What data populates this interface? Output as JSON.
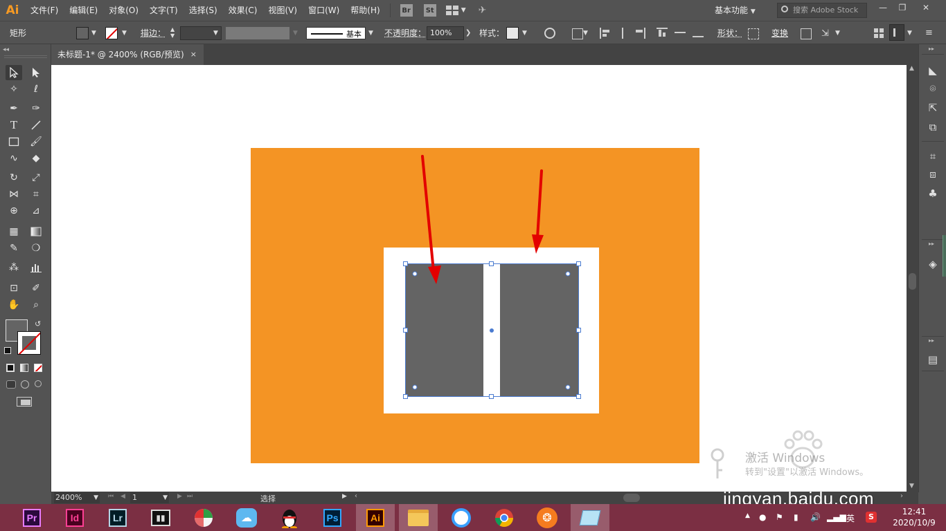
{
  "app": {
    "logo": "Ai"
  },
  "menu": [
    "文件(F)",
    "编辑(E)",
    "对象(O)",
    "文字(T)",
    "选择(S)",
    "效果(C)",
    "视图(V)",
    "窗口(W)",
    "帮助(H)"
  ],
  "bridge": {
    "br": "Br",
    "st": "St"
  },
  "workspace": "基本功能",
  "search_placeholder": "搜索 Adobe Stock",
  "control": {
    "object_type": "矩形",
    "stroke_label": "描边：",
    "stroke_style": "基本",
    "opacity_label": "不透明度：",
    "opacity_value": "100%",
    "style_label": "样式：",
    "shape_label": "形状：",
    "transform_label": "变换"
  },
  "document_tab": {
    "title": "未标题-1* @ 2400% (RGB/预览)",
    "close": "×"
  },
  "status": {
    "zoom": "2400%",
    "artboard": "1",
    "tool_status": "选择"
  },
  "watermark": {
    "line1": "激活 Windows",
    "line2": "转到\"设置\"以激活 Windows。",
    "baidu": "jingyan.baidu.com"
  },
  "taskbar": {
    "apps": [
      "Pr",
      "Id",
      "Lr",
      "Ai",
      "Ps"
    ],
    "ime": "英",
    "time": "12:41",
    "date": "2020/10/9"
  },
  "colors": {
    "artboard": "#f49424",
    "rect_fill": "#646464",
    "arrow": "#e30000",
    "selection": "#4a7bd0",
    "taskbar": "#7b2f43"
  }
}
